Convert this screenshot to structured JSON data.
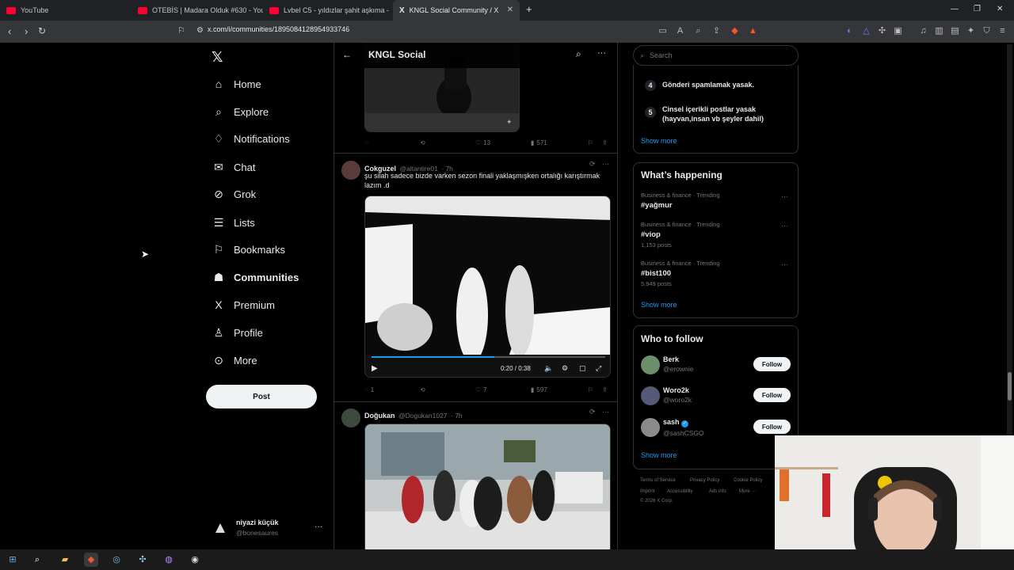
{
  "browser": {
    "tabs": [
      {
        "title": "YouTube",
        "color": "#ff0033"
      },
      {
        "title": "OTEBİS | Madara Olduk #630 - YouTube",
        "color": "#ff0033"
      },
      {
        "title": "Lvbel C5 - yıldızlar şahit aşkıma -",
        "color": "#ff0033"
      },
      {
        "title": "KNGL Social Community / X",
        "color": "#ffffff"
      }
    ],
    "url": "x.com/i/communities/1895084128954933746"
  },
  "nav": {
    "items": [
      {
        "label": "Home",
        "icon": "home-icon",
        "glyph": "⌂"
      },
      {
        "label": "Explore",
        "icon": "search-icon",
        "glyph": "⌕"
      },
      {
        "label": "Notifications",
        "icon": "bell-icon",
        "glyph": "♫"
      },
      {
        "label": "Chat",
        "icon": "mail-icon",
        "glyph": "✉"
      },
      {
        "label": "Grok",
        "icon": "grok-icon",
        "glyph": "⊘"
      },
      {
        "label": "Lists",
        "icon": "list-icon",
        "glyph": "☰"
      },
      {
        "label": "Bookmarks",
        "icon": "bookmark-icon",
        "glyph": "⚐"
      },
      {
        "label": "Communities",
        "icon": "communities-icon",
        "glyph": "👥"
      },
      {
        "label": "Premium",
        "icon": "x-logo-icon",
        "glyph": "𝕏"
      },
      {
        "label": "Profile",
        "icon": "person-icon",
        "glyph": "⚲"
      },
      {
        "label": "More",
        "icon": "more-circle-icon",
        "glyph": "⊙"
      }
    ],
    "post_label": "Post",
    "account": {
      "name": "niyazi küçük",
      "handle": "@bonesaures"
    }
  },
  "community": {
    "title": "KNGL Social",
    "posts": [
      {
        "replies": "",
        "reposts": "",
        "likes": "13",
        "views": "571"
      },
      {
        "name": "Cokguzel",
        "handle": "@altantire01",
        "time": "· 7h",
        "text": "şu silah sadece bizde varken sezon finali yaklaşmışken ortalığı karıştırmak lazım .d",
        "video_time": "0:20 / 0:38",
        "replies": "1",
        "reposts": "",
        "likes": "7",
        "views": "597"
      },
      {
        "name": "Doğukan",
        "handle": "@Dogukan1027",
        "time": "· 7h"
      }
    ]
  },
  "right": {
    "search_placeholder": "Search",
    "rules": [
      {
        "num": "4",
        "text": "Gönderi spamlamak yasak."
      },
      {
        "num": "5",
        "text": "Cinsel içerikli postlar yasak (hayvan,insan vb şeyler dahil)"
      }
    ],
    "show_more": "Show more",
    "happening_title": "What’s happening",
    "trends": [
      {
        "cat": "Business & finance · Trending",
        "tag": "#yağmur",
        "count": ""
      },
      {
        "cat": "Business & finance · Trending",
        "tag": "#viop",
        "count": "1,153 posts"
      },
      {
        "cat": "Business & finance · Trending",
        "tag": "#bist100",
        "count": "5,949 posts"
      }
    ],
    "who_title": "Who to follow",
    "follow_label": "Follow",
    "who": [
      {
        "name": "Berk",
        "handle": "@erownie",
        "verified": false
      },
      {
        "name": "Woro2k",
        "handle": "@woro2k",
        "verified": false
      },
      {
        "name": "sash",
        "handle": "@sashCSGO",
        "verified": true
      }
    ],
    "footer": [
      "Terms of Service",
      "Privacy Policy",
      "Cookie Policy",
      "Imprint",
      "Accessibility",
      "Ads info",
      "More ···",
      "© 2026 X Corp."
    ]
  },
  "colors": {
    "accent": "#1d9bf0",
    "border": "#2f3336",
    "muted": "#71767b"
  }
}
